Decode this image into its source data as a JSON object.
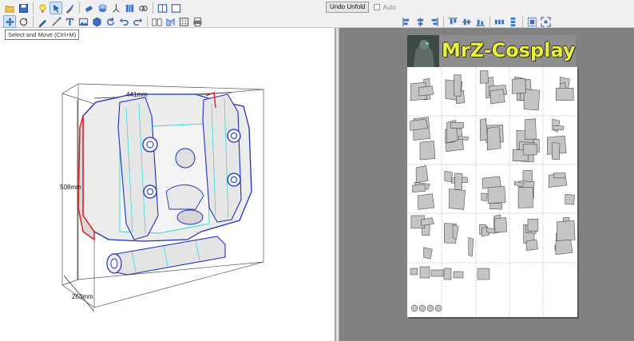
{
  "toolbar": {
    "row1_icons": [
      "open-folder-icon",
      "save-icon",
      "lightbulb-icon",
      "select-move-icon",
      "paint-icon",
      "eraser-icon",
      "joint-icon",
      "pin-icon",
      "grid-icon",
      "link-icon",
      "window-single-icon",
      "window-split-icon"
    ],
    "row2_icons": [
      "select-move-arrow-icon",
      "rotate-view-icon",
      "pen-line-icon",
      "edit-line-icon",
      "text-icon",
      "image-icon",
      "box-icon",
      "refresh-icon",
      "undo-arrow-icon",
      "redo-arrow-icon",
      "book-icon",
      "unfold-icon",
      "table-icon",
      "print-icon"
    ],
    "undo_unfold_label": "Undo Unfold",
    "auto_label": "Auto",
    "align_icons": [
      "align-left-icon",
      "align-center-icon",
      "align-right-icon",
      "align-top-icon",
      "align-middle-icon",
      "align-bottom-icon",
      "distribute-h-icon",
      "distribute-v-icon",
      "group-icon",
      "fit-icon"
    ]
  },
  "tooltip": "Select and Move (Ctrl+M)",
  "model_view": {
    "dim_width": "441mm",
    "dim_height": "508mm",
    "dim_depth": "263mm"
  },
  "sheet_view": {
    "banner_title": "MrZ-Cosplay"
  },
  "colors": {
    "accent": "#3c78d8",
    "sheet_bg": "#818181",
    "banner_text": "#e8f23a",
    "model_blue": "#1f2fc0",
    "model_cyan": "#2ad5d5",
    "model_red": "#e01b1b"
  }
}
